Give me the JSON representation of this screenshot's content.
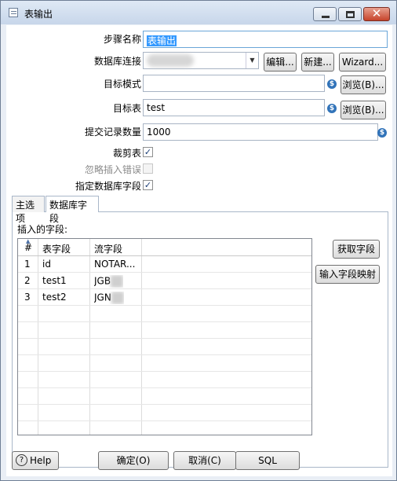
{
  "window": {
    "title": "表输出"
  },
  "form": {
    "step_name_label": "步骤名称",
    "step_name_value": "表输出",
    "connection_label": "数据库连接",
    "edit_label": "编辑...",
    "new_label": "新建...",
    "wizard_label": "Wizard...",
    "target_schema_label": "目标模式",
    "target_schema_value": "",
    "browse_label": "浏览(B)...",
    "target_table_label": "目标表",
    "target_table_value": "test",
    "commit_size_label": "提交记录数量",
    "commit_size_value": "1000",
    "truncate_label": "裁剪表",
    "truncate_checked": true,
    "ignore_errors_label": "忽略插入错误",
    "ignore_errors_checked": false,
    "specify_fields_label": "指定数据库字段",
    "specify_fields_checked": true
  },
  "tabs": [
    {
      "label": "主选项"
    },
    {
      "label": "数据库字段"
    }
  ],
  "fields_panel": {
    "title": "插入的字段:",
    "columns": [
      "#",
      "表字段",
      "流字段"
    ],
    "rows": [
      {
        "num": "1",
        "table_field": "id",
        "stream_field": "NOTAR..."
      },
      {
        "num": "2",
        "table_field": "test1",
        "stream_field": "JGB"
      },
      {
        "num": "3",
        "table_field": "test2",
        "stream_field": "JGN"
      }
    ],
    "get_fields_label": "获取字段",
    "enter_mapping_label": "输入字段映射"
  },
  "footer": {
    "help_label": "Help",
    "ok_label": "确定(O)",
    "cancel_label": "取消(C)",
    "sql_label": "SQL"
  }
}
